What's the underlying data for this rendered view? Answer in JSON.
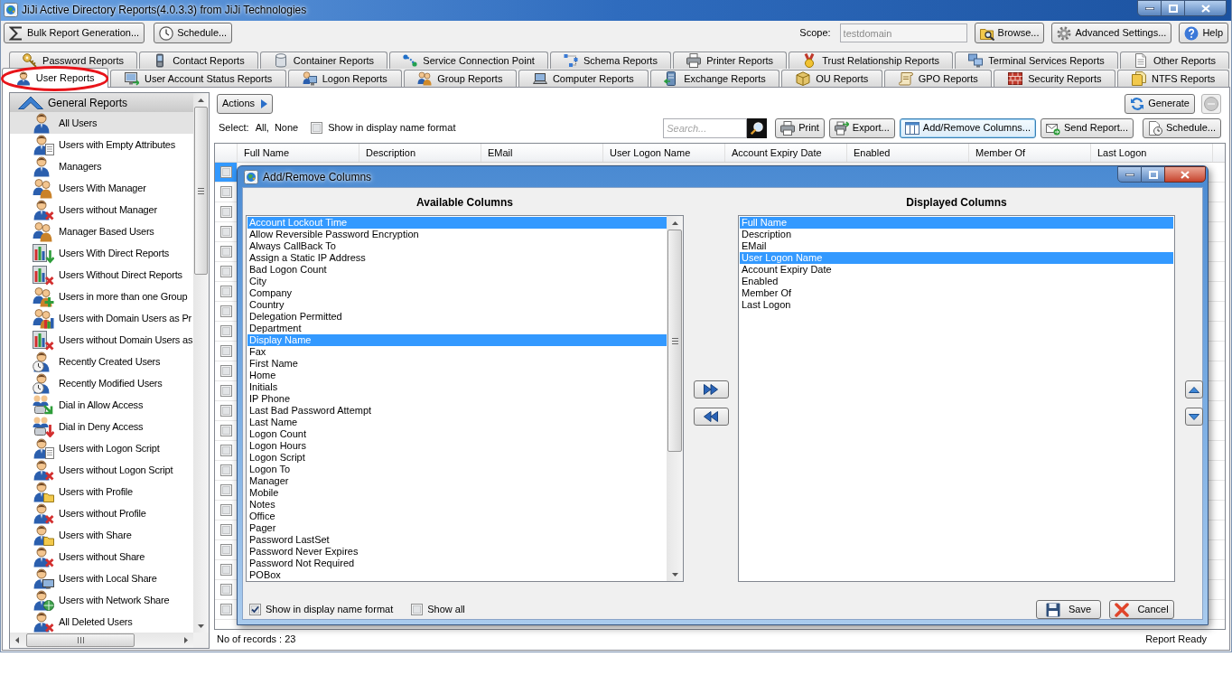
{
  "window": {
    "title": "JiJi Active Directory Reports(4.0.3.3) from JiJi Technologies"
  },
  "toolbar": {
    "left_buttons": [
      {
        "label": "Bulk Report Generation...",
        "kind": "bulk"
      },
      {
        "label": "Schedule...",
        "kind": "schedule"
      }
    ],
    "scope": {
      "label": "Scope:",
      "value": "testdomain",
      "disabled": true
    },
    "right_buttons": [
      {
        "label": "Browse...",
        "kind": "browse"
      },
      {
        "label": "Advanced Settings...",
        "kind": "settings"
      },
      {
        "label": "Help",
        "kind": "help"
      }
    ]
  },
  "tab_rows": [
    {
      "tabs": [
        {
          "label": "Password Reports",
          "kind": "password",
          "selected": false,
          "highlighted": false
        },
        {
          "label": "Contact Reports",
          "kind": "contact",
          "selected": false,
          "highlighted": false
        },
        {
          "label": "Container Reports",
          "kind": "container",
          "selected": false,
          "highlighted": false
        },
        {
          "label": "Service Connection Point",
          "kind": "service",
          "selected": false,
          "highlighted": false
        },
        {
          "label": "Schema Reports",
          "kind": "schema",
          "selected": false,
          "highlighted": false
        },
        {
          "label": "Printer Reports",
          "kind": "printer",
          "selected": false,
          "highlighted": false
        },
        {
          "label": "Trust Relationship Reports",
          "kind": "trust",
          "selected": false,
          "highlighted": false
        },
        {
          "label": "Terminal Services Reports",
          "kind": "terminal",
          "selected": false,
          "highlighted": false
        },
        {
          "label": "Other Reports",
          "kind": "other",
          "selected": false,
          "highlighted": false
        }
      ]
    },
    {
      "tabs": [
        {
          "label": "User Reports",
          "kind": "user",
          "selected": true,
          "highlighted": true
        },
        {
          "label": "User Account Status Reports",
          "kind": "status",
          "selected": false,
          "highlighted": false
        },
        {
          "label": "Logon Reports",
          "kind": "logon",
          "selected": false,
          "highlighted": false
        },
        {
          "label": "Group Reports",
          "kind": "group",
          "selected": false,
          "highlighted": false
        },
        {
          "label": "Computer Reports",
          "kind": "computer",
          "selected": false,
          "highlighted": false
        },
        {
          "label": "Exchange Reports",
          "kind": "exchange",
          "selected": false,
          "highlighted": false
        },
        {
          "label": "OU Reports",
          "kind": "ou",
          "selected": false,
          "highlighted": false
        },
        {
          "label": "GPO Reports",
          "kind": "gpo",
          "selected": false,
          "highlighted": false
        },
        {
          "label": "Security Reports",
          "kind": "security",
          "selected": false,
          "highlighted": false
        },
        {
          "label": "NTFS Reports",
          "kind": "ntfs",
          "selected": false,
          "highlighted": false
        }
      ]
    }
  ],
  "sidebar": {
    "group": {
      "label": "General Reports",
      "expanded": true
    },
    "items": [
      {
        "label": "All Users",
        "kind": "user",
        "selected": true
      },
      {
        "label": "Users with Empty Attributes",
        "kind": "user-doc",
        "selected": false
      },
      {
        "label": "Managers",
        "kind": "user",
        "selected": false
      },
      {
        "label": "Users With Manager",
        "kind": "users",
        "selected": false
      },
      {
        "label": "Users without Manager",
        "kind": "user-cross",
        "selected": false
      },
      {
        "label": "Manager Based Users",
        "kind": "users",
        "selected": false
      },
      {
        "label": "Users With Direct Reports",
        "kind": "chart-arrow",
        "selected": false
      },
      {
        "label": "Users Without Direct Reports",
        "kind": "chart-cross",
        "selected": false
      },
      {
        "label": "Users in more than one Group",
        "kind": "user-plus",
        "selected": false
      },
      {
        "label": "Users with Domain Users as Pr",
        "kind": "user-chart",
        "selected": false
      },
      {
        "label": "Users without Domain Users as",
        "kind": "chart-cross",
        "selected": false
      },
      {
        "label": "Recently Created Users",
        "kind": "user-clock",
        "selected": false
      },
      {
        "label": "Recently Modified Users",
        "kind": "user-clock",
        "selected": false
      },
      {
        "label": "Dial in Allow Access",
        "kind": "dial-allow",
        "selected": false
      },
      {
        "label": "Dial in Deny Access",
        "kind": "dial-deny",
        "selected": false
      },
      {
        "label": "Users with Logon Script",
        "kind": "user-doc",
        "selected": false
      },
      {
        "label": "Users without Logon Script",
        "kind": "user-cross",
        "selected": false
      },
      {
        "label": "Users with Profile",
        "kind": "user-folder",
        "selected": false
      },
      {
        "label": "Users without Profile",
        "kind": "user-cross",
        "selected": false
      },
      {
        "label": "Users with Share",
        "kind": "user-folder",
        "selected": false
      },
      {
        "label": "Users without Share",
        "kind": "user-cross",
        "selected": false
      },
      {
        "label": "Users with Local Share",
        "kind": "user-computer",
        "selected": false
      },
      {
        "label": "Users with Network Share",
        "kind": "user-network",
        "selected": false
      },
      {
        "label": "All Deleted Users",
        "kind": "user-cross",
        "selected": false
      }
    ]
  },
  "report_panel": {
    "actions": {
      "label": "Actions"
    },
    "generate": {
      "label": "Generate"
    },
    "stop": {
      "disabled": true
    },
    "select": {
      "label": "Select:",
      "links": [
        "All,",
        "None"
      ]
    },
    "display_name_format": {
      "label": "Show in display name format",
      "checked": false
    },
    "search": {
      "placeholder": "Search..."
    },
    "buttons": [
      {
        "label": "Print",
        "kind": "print",
        "focused": false
      },
      {
        "label": "Export...",
        "kind": "export",
        "focused": false
      },
      {
        "label": "Add/Remove Columns...",
        "kind": "columns",
        "focused": true
      },
      {
        "label": "Send Report...",
        "kind": "send",
        "focused": false
      },
      {
        "label": "Schedule...",
        "kind": "schedule",
        "focused": false
      }
    ]
  },
  "table": {
    "columns": [
      "Full Name",
      "Description",
      "EMail",
      "User Logon Name",
      "Account Expiry Date",
      "Enabled",
      "Member Of",
      "Last Logon"
    ],
    "rows": [
      {
        "selected": true,
        "checked": false
      },
      {
        "selected": false,
        "checked": false
      },
      {
        "selected": false,
        "checked": false
      },
      {
        "selected": false,
        "checked": false
      },
      {
        "selected": false,
        "checked": false
      },
      {
        "selected": false,
        "checked": false
      },
      {
        "selected": false,
        "checked": false
      },
      {
        "selected": false,
        "checked": false
      },
      {
        "selected": false,
        "checked": false
      },
      {
        "selected": false,
        "checked": false
      },
      {
        "selected": false,
        "checked": false
      },
      {
        "selected": false,
        "checked": false
      },
      {
        "selected": false,
        "checked": false
      },
      {
        "selected": false,
        "checked": false
      },
      {
        "selected": false,
        "checked": false
      },
      {
        "selected": false,
        "checked": false
      },
      {
        "selected": false,
        "checked": false
      },
      {
        "selected": false,
        "checked": false
      },
      {
        "selected": false,
        "checked": false
      },
      {
        "selected": false,
        "checked": false
      },
      {
        "selected": false,
        "checked": false
      },
      {
        "selected": false,
        "checked": false
      },
      {
        "selected": false,
        "checked": false
      }
    ]
  },
  "status_bar": {
    "records": "No of records : 23",
    "status": "Report Ready"
  },
  "dialog": {
    "title": "Add/Remove Columns",
    "available": {
      "heading": "Available Columns",
      "items": [
        {
          "label": "Account Lockout Time",
          "selected": true
        },
        {
          "label": "Allow Reversible Password Encryption",
          "selected": false
        },
        {
          "label": "Always CallBack To",
          "selected": false
        },
        {
          "label": "Assign a Static IP Address",
          "selected": false
        },
        {
          "label": "Bad Logon Count",
          "selected": false
        },
        {
          "label": "City",
          "selected": false
        },
        {
          "label": "Company",
          "selected": false
        },
        {
          "label": "Country",
          "selected": false
        },
        {
          "label": "Delegation Permitted",
          "selected": false
        },
        {
          "label": "Department",
          "selected": false
        },
        {
          "label": "Display Name",
          "selected": true
        },
        {
          "label": "Fax",
          "selected": false
        },
        {
          "label": "First Name",
          "selected": false
        },
        {
          "label": "Home",
          "selected": false
        },
        {
          "label": "Initials",
          "selected": false
        },
        {
          "label": "IP Phone",
          "selected": false
        },
        {
          "label": "Last Bad Password Attempt",
          "selected": false
        },
        {
          "label": "Last Name",
          "selected": false
        },
        {
          "label": "Logon Count",
          "selected": false
        },
        {
          "label": "Logon Hours",
          "selected": false
        },
        {
          "label": "Logon Script",
          "selected": false
        },
        {
          "label": "Logon To",
          "selected": false
        },
        {
          "label": "Manager",
          "selected": false
        },
        {
          "label": "Mobile",
          "selected": false
        },
        {
          "label": "Notes",
          "selected": false
        },
        {
          "label": "Office",
          "selected": false
        },
        {
          "label": "Pager",
          "selected": false
        },
        {
          "label": "Password LastSet",
          "selected": false
        },
        {
          "label": "Password Never Expires",
          "selected": false
        },
        {
          "label": "Password Not Required",
          "selected": false
        },
        {
          "label": "POBox",
          "selected": false
        }
      ]
    },
    "displayed": {
      "heading": "Displayed Columns",
      "items": [
        {
          "label": "Full Name",
          "selected": true
        },
        {
          "label": "Description",
          "selected": false
        },
        {
          "label": "EMail",
          "selected": false
        },
        {
          "label": "User Logon Name",
          "selected": true
        },
        {
          "label": "Account Expiry Date",
          "selected": false
        },
        {
          "label": "Enabled",
          "selected": false
        },
        {
          "label": "Member Of",
          "selected": false
        },
        {
          "label": "Last Logon",
          "selected": false
        }
      ]
    },
    "options": [
      {
        "label": "Show in display name format",
        "checked": true
      },
      {
        "label": "Show all",
        "checked": false
      }
    ],
    "buttons": [
      {
        "label": "Save",
        "kind": "save"
      },
      {
        "label": "Cancel",
        "kind": "cancel"
      }
    ]
  }
}
